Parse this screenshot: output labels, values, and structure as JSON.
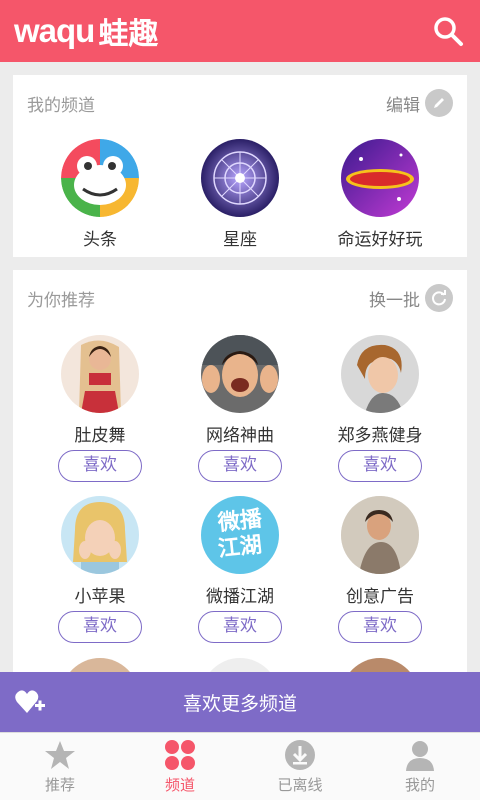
{
  "header": {
    "logo_latin": "waqu",
    "logo_cn": "蛙趣"
  },
  "my_channels": {
    "title": "我的频道",
    "action": "编辑",
    "items": [
      {
        "name": "头条",
        "icon": "frog-logo-icon"
      },
      {
        "name": "星座",
        "icon": "zodiac-wheel-icon"
      },
      {
        "name": "命运好好玩",
        "icon": "fortune-show-icon"
      }
    ]
  },
  "recommend": {
    "title": "为你推荐",
    "action": "换一批",
    "like_label": "喜欢",
    "items": [
      {
        "name": "肚皮舞"
      },
      {
        "name": "网络神曲"
      },
      {
        "name": "郑多燕健身"
      },
      {
        "name": "小苹果"
      },
      {
        "name": "微播江湖",
        "thumb_text_1": "微播",
        "thumb_text_2": "江湖"
      },
      {
        "name": "创意广告"
      }
    ]
  },
  "promo": {
    "label": "喜欢更多频道"
  },
  "tabs": [
    {
      "label": "推荐",
      "icon": "star-icon",
      "active": false
    },
    {
      "label": "频道",
      "icon": "grid-dots-icon",
      "active": true
    },
    {
      "label": "已离线",
      "icon": "download-icon",
      "active": false
    },
    {
      "label": "我的",
      "icon": "person-icon",
      "active": false
    }
  ],
  "colors": {
    "brand": "#f5566a",
    "accent": "#7e6bc7",
    "card_bg": "#ffffff",
    "page_bg": "#ececec"
  }
}
